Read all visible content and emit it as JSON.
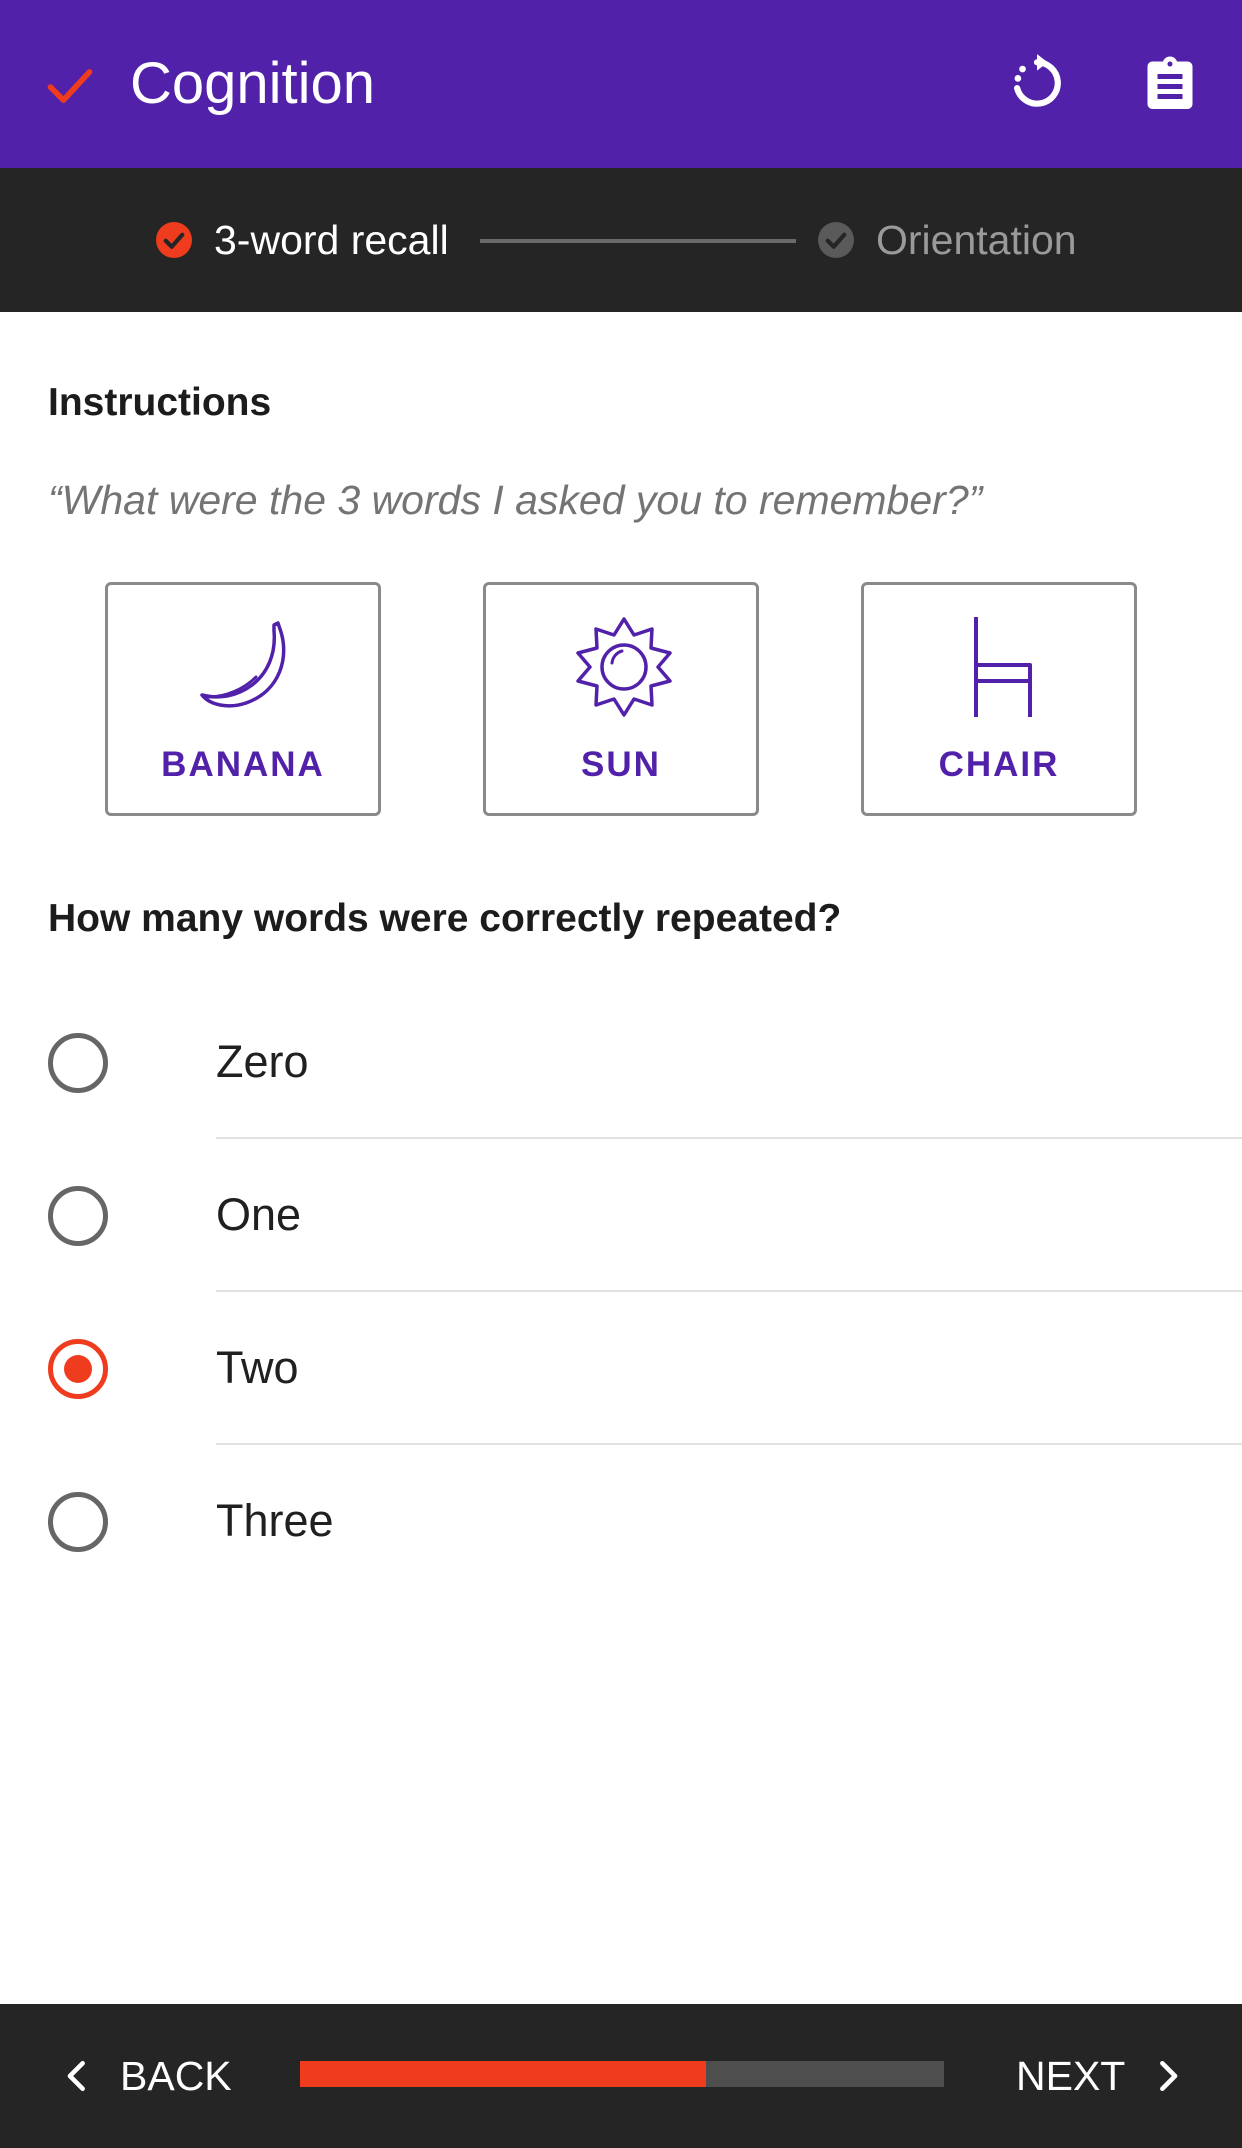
{
  "app_bar": {
    "title": "Cognition",
    "colors": {
      "background": "#5221a9",
      "check": "#f03c1e"
    },
    "icons": [
      "check-icon",
      "reset-icon",
      "clipboard-icon"
    ]
  },
  "stepper": {
    "steps": [
      {
        "label": "3-word recall",
        "state": "active"
      },
      {
        "label": "Orientation",
        "state": "pending"
      }
    ]
  },
  "instructions": {
    "heading": "Instructions",
    "quote": "“What were the 3 words I asked you to remember?”"
  },
  "words": [
    {
      "label": "BANANA",
      "icon": "banana-icon"
    },
    {
      "label": "SUN",
      "icon": "sun-icon"
    },
    {
      "label": "CHAIR",
      "icon": "chair-icon"
    }
  ],
  "question": "How many words were correctly repeated?",
  "options": [
    {
      "label": "Zero",
      "selected": false
    },
    {
      "label": "One",
      "selected": false
    },
    {
      "label": "Two",
      "selected": true
    },
    {
      "label": "Three",
      "selected": false
    }
  ],
  "bottom_bar": {
    "back_label": "BACK",
    "next_label": "NEXT",
    "progress": 0.63,
    "accent": "#f03c1e"
  }
}
